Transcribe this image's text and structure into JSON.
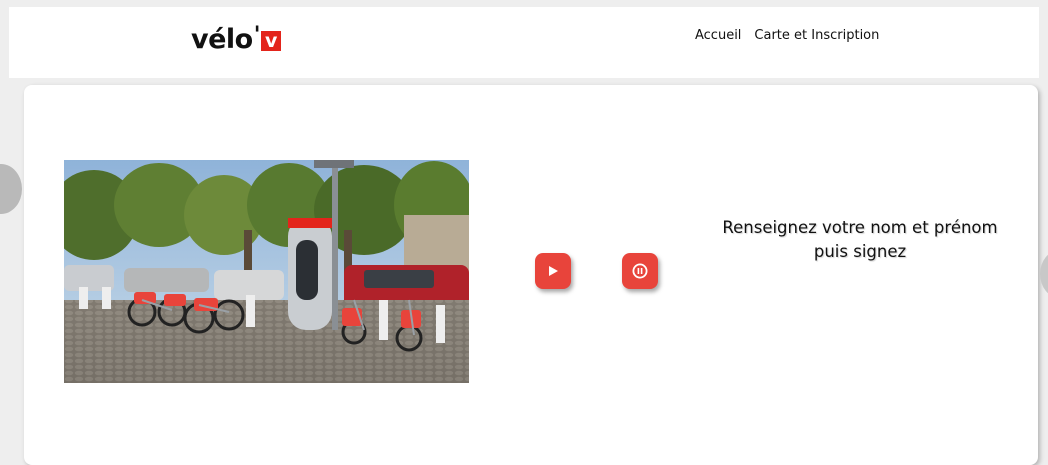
{
  "header": {
    "logo": {
      "text": "vélo",
      "apostrophe": "'",
      "badge": "v",
      "badge_color": "#e3241b"
    },
    "nav": [
      {
        "label": "Accueil"
      },
      {
        "label": "Carte et Inscription"
      }
    ]
  },
  "slider": {
    "caption": "Renseignez votre nom et prénom puis signez",
    "controls": {
      "play_icon": "play-icon",
      "pause_icon": "pause-icon",
      "accent": "#e8443b"
    }
  }
}
